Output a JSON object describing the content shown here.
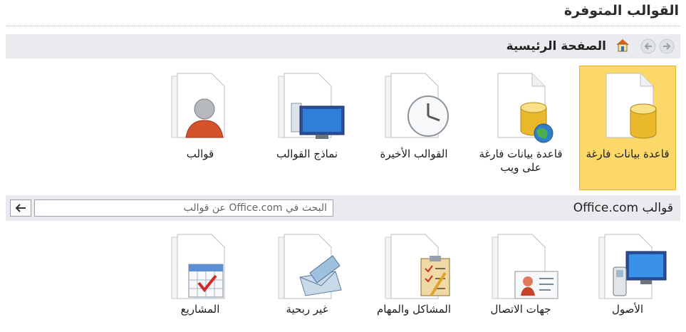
{
  "header": {
    "title": "القوالب المتوفرة"
  },
  "nav": {
    "home_label": "الصفحة الرئيسية"
  },
  "top_tiles": [
    {
      "label": "قاعدة بيانات فارغة",
      "icon": "blank-database-icon",
      "selected": true
    },
    {
      "label": "قاعدة بيانات فارغة على ويب",
      "icon": "blank-web-database-icon"
    },
    {
      "label": "القوالب الأخيرة",
      "icon": "recent-templates-icon"
    },
    {
      "label": "نماذج القوالب",
      "icon": "sample-templates-icon"
    },
    {
      "label": "قوالب",
      "icon": "my-templates-icon"
    }
  ],
  "office": {
    "label": "قوالب Office.com",
    "search_placeholder": "البحث في Office.com عن قوالب"
  },
  "bottom_tiles": [
    {
      "label": "الأصول",
      "icon": "assets-icon"
    },
    {
      "label": "جهات الاتصال",
      "icon": "contacts-icon"
    },
    {
      "label": "المشاكل والمهام",
      "icon": "issues-tasks-icon"
    },
    {
      "label": "غير ربحية",
      "icon": "non-profit-icon"
    },
    {
      "label": "المشاريع",
      "icon": "projects-icon"
    }
  ],
  "colors": {
    "selected_bg": "#fcd868",
    "bar_bg": "#e9ebee"
  }
}
